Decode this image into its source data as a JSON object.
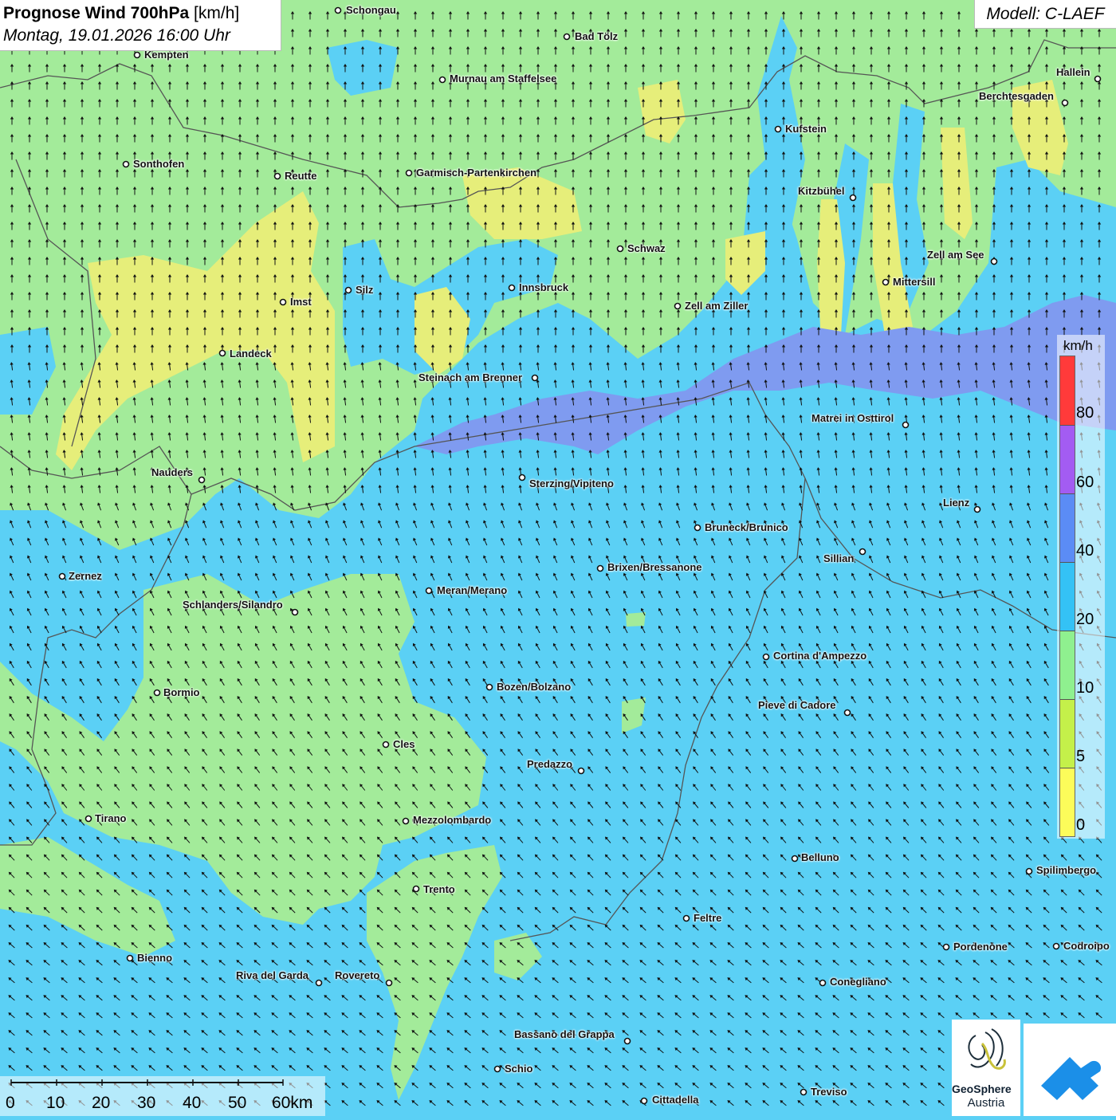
{
  "header": {
    "title_bold": "Prognose Wind 700hPa",
    "title_unit": "[km/h]",
    "datetime": "Montag, 19.01.2026 16:00 Uhr",
    "model": "Modell: C-LAEF"
  },
  "legend": {
    "unit": "km/h",
    "ticks": [
      "80",
      "60",
      "40",
      "20",
      "10",
      "5",
      "0"
    ],
    "colors": [
      "#ff3a3a",
      "#a35cf2",
      "#5b8cf5",
      "#34c2f5",
      "#8ff08f",
      "#c4f04a",
      "#fcfc5a"
    ]
  },
  "scale_bar": {
    "labels": [
      "0",
      "10",
      "20",
      "30",
      "40",
      "50",
      "60km"
    ]
  },
  "logo": {
    "name_line1": "GeoSphere",
    "name_line2": "Austria"
  },
  "colors": {
    "ocean_blue": "#5bd0f5",
    "green": "#a3eb9a",
    "yellow": "#e6ee7a",
    "purple": "#7f9bf0",
    "border_line": "#555555",
    "brand_blue": "#1b8fe8"
  },
  "cities": [
    {
      "name": "Schongau"
    },
    {
      "name": "Bad Tölz"
    },
    {
      "name": "Kempten"
    },
    {
      "name": "Murnau am Staffelsee"
    },
    {
      "name": "Hallein"
    },
    {
      "name": "Berchtesgaden"
    },
    {
      "name": "Kufstein"
    },
    {
      "name": "Sonthofen"
    },
    {
      "name": "Reutte"
    },
    {
      "name": "Garmisch-Partenkirchen"
    },
    {
      "name": "Kitzbühel"
    },
    {
      "name": "Schwaz"
    },
    {
      "name": "Zell am See"
    },
    {
      "name": "Mittersill"
    },
    {
      "name": "Innsbruck"
    },
    {
      "name": "Silz"
    },
    {
      "name": "Imst"
    },
    {
      "name": "Zell am Ziller"
    },
    {
      "name": "Landeck"
    },
    {
      "name": "Steinach am Brenner"
    },
    {
      "name": "Matrei in Osttirol"
    },
    {
      "name": "Nauders"
    },
    {
      "name": "Sterzing/Vipiteno"
    },
    {
      "name": "Lienz"
    },
    {
      "name": "Bruneck/Brunico"
    },
    {
      "name": "Sillian"
    },
    {
      "name": "Brixen/Bressanone"
    },
    {
      "name": "Zernez"
    },
    {
      "name": "Meran/Merano"
    },
    {
      "name": "Schlanders/Silandro"
    },
    {
      "name": "Cortina d'Ampezzo"
    },
    {
      "name": "Bozen/Bolzano"
    },
    {
      "name": "Bormio"
    },
    {
      "name": "Pieve di Cadore"
    },
    {
      "name": "Cles"
    },
    {
      "name": "Predazzo"
    },
    {
      "name": "Tirano"
    },
    {
      "name": "Mezzolombardo"
    },
    {
      "name": "Belluno"
    },
    {
      "name": "Spilimbergo"
    },
    {
      "name": "Trento"
    },
    {
      "name": "Feltre"
    },
    {
      "name": "Pordenone"
    },
    {
      "name": "Codroipo"
    },
    {
      "name": "Bienno"
    },
    {
      "name": "Riva del Garda"
    },
    {
      "name": "Rovereto"
    },
    {
      "name": "Conegliano"
    },
    {
      "name": "Bassano del Grappa"
    },
    {
      "name": "Schio"
    },
    {
      "name": "Treviso"
    },
    {
      "name": "Cittadella"
    }
  ]
}
